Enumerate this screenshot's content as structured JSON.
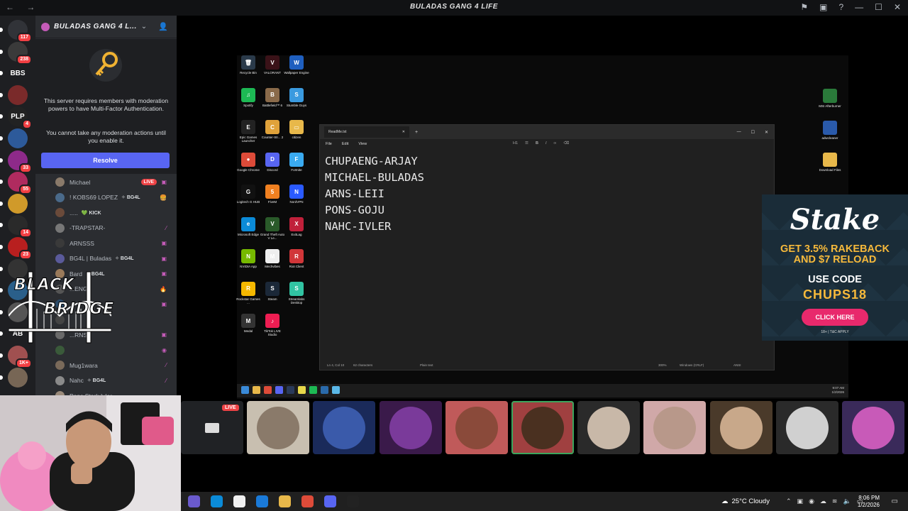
{
  "window": {
    "title": "BULADAS GANG 4 LIFE",
    "back": "←",
    "forward": "→"
  },
  "rail": {
    "items": [
      {
        "label": "",
        "badge": "117",
        "color": "#313338"
      },
      {
        "label": "",
        "badge": "238",
        "color": "#3a3a3a"
      },
      {
        "label": "BBS",
        "badge": "",
        "color": "#1e1f22"
      },
      {
        "label": "",
        "badge": "",
        "color": "#7a2a2a"
      },
      {
        "label": "PLP",
        "badge": "4",
        "color": "#222"
      },
      {
        "label": "",
        "badge": "",
        "color": "#2d5a9a"
      },
      {
        "label": "",
        "badge": "33",
        "color": "#8e2a8a"
      },
      {
        "label": "",
        "badge": "55",
        "color": "#b02b5f"
      },
      {
        "label": "",
        "badge": "",
        "color": "#d09a2a"
      },
      {
        "label": "",
        "badge": "14",
        "color": "#2a2a2a"
      },
      {
        "label": "",
        "badge": "23",
        "color": "#b81f1f"
      },
      {
        "label": "",
        "badge": "",
        "color": "#333"
      },
      {
        "label": "",
        "badge": "",
        "color": "#2a5f8a"
      },
      {
        "label": "",
        "badge": "",
        "color": "#555"
      },
      {
        "label": "AB",
        "badge": "",
        "color": "#1e1f22"
      },
      {
        "label": "",
        "badge": "1K+",
        "color": "#a05050"
      },
      {
        "label": "",
        "badge": "",
        "color": "#776655"
      }
    ]
  },
  "sidebar": {
    "server_name": "BULADAS GANG 4 L...",
    "mfa_text_1": "This server requires members with moderation powers to have Multi-Factor Authentication.",
    "mfa_text_2": "You cannot take any moderation actions until you enable it.",
    "resolve_label": "Resolve",
    "members": [
      {
        "name": "Michael",
        "tag": "",
        "live": "LIVE",
        "icon": "▣"
      },
      {
        "name": "! KOBS69 LOPEZ",
        "tag": "✧ BG4L",
        "live": "",
        "icon": "🍔"
      },
      {
        "name": ".....",
        "tag": "💚 KICK",
        "live": "",
        "icon": ""
      },
      {
        "name": "-TRAPSTAR-",
        "tag": "",
        "live": "",
        "icon": "⁄"
      },
      {
        "name": "ARNSSS",
        "tag": "",
        "live": "",
        "icon": "▣"
      },
      {
        "name": "BG4L | Buladas",
        "tag": "✧ BG4L",
        "live": "",
        "icon": "▣"
      },
      {
        "name": "Bard",
        "tag": "✧ BG4L",
        "live": "",
        "icon": "▣"
      },
      {
        "name": "...ENG",
        "tag": "",
        "live": "",
        "icon": "🔥"
      },
      {
        "name": "",
        "tag": "",
        "live": "",
        "icon": "▣"
      },
      {
        "name": "",
        "tag": "",
        "live": "",
        "icon": ""
      },
      {
        "name": "...RNS",
        "tag": "",
        "live": "",
        "icon": "▣"
      },
      {
        "name": "",
        "tag": "",
        "live": "",
        "icon": "◉"
      },
      {
        "name": "Mug1wara",
        "tag": "",
        "live": "",
        "icon": "⁄"
      },
      {
        "name": "Nahc",
        "tag": "✧ BG4L",
        "live": "",
        "icon": "⁄"
      },
      {
        "name": "Pons Stark Ivler",
        "tag": "",
        "live": "",
        "icon": ""
      }
    ]
  },
  "desktop_icons": [
    {
      "label": "Recycle Bin",
      "color": "#2a3a4a",
      "glyph": "🗑"
    },
    {
      "label": "VALORANT",
      "color": "#3a1218",
      "glyph": "V"
    },
    {
      "label": "Wallpaper Engine",
      "color": "#1f5fbf",
      "glyph": "W"
    },
    {
      "label": "Spotify",
      "color": "#1db954",
      "glyph": "♫"
    },
    {
      "label": "Battlefield™ 6",
      "color": "#8a6a4a",
      "glyph": "B"
    },
    {
      "label": "Stumble Guys",
      "color": "#3a9adf",
      "glyph": "S"
    },
    {
      "label": "Epic Games Launcher",
      "color": "#222",
      "glyph": "E"
    },
    {
      "label": "Counter-Str... 2",
      "color": "#e0a23a",
      "glyph": "C"
    },
    {
      "label": "citizen",
      "color": "#e8b84a",
      "glyph": "▭"
    },
    {
      "label": "Google Chrome",
      "color": "#dd4b39",
      "glyph": "●"
    },
    {
      "label": "Discord",
      "color": "#5865f2",
      "glyph": "D"
    },
    {
      "label": "Fortnite",
      "color": "#3aaaf0",
      "glyph": "F"
    },
    {
      "label": "Logitech G HUB",
      "color": "#111",
      "glyph": "G"
    },
    {
      "label": "FiveM",
      "color": "#f08020",
      "glyph": "5"
    },
    {
      "label": "NordVPN",
      "color": "#2a5aff",
      "glyph": "N"
    },
    {
      "label": "Microsoft Edge",
      "color": "#0b8bd8",
      "glyph": "e"
    },
    {
      "label": "Grand Theft Auto V Le...",
      "color": "#2a5a2a",
      "glyph": "V"
    },
    {
      "label": "ExitLag",
      "color": "#c0203a",
      "glyph": "X"
    },
    {
      "label": "NVIDIA App",
      "color": "#76b900",
      "glyph": "N"
    },
    {
      "label": "Mechvibes",
      "color": "#eee",
      "glyph": "M"
    },
    {
      "label": "Riot Client",
      "color": "#d13639",
      "glyph": "R"
    },
    {
      "label": "Rockstar Games ...",
      "color": "#f5b800",
      "glyph": "R"
    },
    {
      "label": "Steam",
      "color": "#1b2838",
      "glyph": "S"
    },
    {
      "label": "Streamlabs Desktop",
      "color": "#31c3a2",
      "glyph": "S"
    },
    {
      "label": "Medal",
      "color": "#333",
      "glyph": "M"
    },
    {
      "label": "TikTok LIVE Studio",
      "color": "#ee1d52",
      "glyph": "♪"
    }
  ],
  "desktop_right_icons": [
    {
      "label": "MSI Afterburner",
      "color": "#2a7a3a"
    },
    {
      "label": "adwcleaner",
      "color": "#2a5aaa"
    },
    {
      "label": "Download Files",
      "color": "#e8b84a"
    }
  ],
  "notepad": {
    "tab_title": "ReadMe.txt",
    "menu": [
      "File",
      "Edit",
      "View"
    ],
    "heading_tool": "H1",
    "lines": [
      "CHUPAENG-ARJAY",
      "MICHAEL-BULADAS",
      "ARNS-LEII",
      "PONS-GOJU",
      "NAHC-IVLER"
    ],
    "status_pos": "Ln 4, Col 10",
    "status_chars": "62 characters",
    "status_format": "Plain text",
    "status_zoom": "300%",
    "status_eol": "Windows (CRLF)",
    "status_enc": "ANSI"
  },
  "inner_taskbar": {
    "time": "9:07 AM",
    "date": "1/2/2026"
  },
  "stake_ad": {
    "logo": "Stake",
    "line1": "GET 3.5% RAKEBACK",
    "line1b": "AND $7 RELOAD",
    "line2": "USE CODE",
    "code": "CHUPS18",
    "button": "CLICK HERE",
    "fine": "18+ | T&C APPLY"
  },
  "overlay_logo": {
    "line1": "BLACK",
    "line2": "BRIDGE"
  },
  "call": {
    "live_tag": "LIVE",
    "tiles": [
      {
        "color": "#202225",
        "face": "#333"
      },
      {
        "color": "#c8bfb0",
        "face": "#8a7a6a"
      },
      {
        "color": "#1a2a5a",
        "face": "#3a5aaa"
      },
      {
        "color": "#3a1a4a",
        "face": "#7a3a9a"
      },
      {
        "color": "#c05a5a",
        "face": "#8a4a3a"
      },
      {
        "color": "#a04040",
        "face": "#4a3020"
      },
      {
        "color": "#2a2a2a",
        "face": "#c8b8a8"
      },
      {
        "color": "#d0a8a8",
        "face": "#b8988a"
      },
      {
        "color": "#4a3a2a",
        "face": "#c8a88a"
      },
      {
        "color": "#2a2a2a",
        "face": "#d0d0d0"
      },
      {
        "color": "#3a2a5a",
        "face": "#c85ab8"
      }
    ]
  },
  "taskbar": {
    "weather": "25°C Cloudy",
    "time": "8:06 PM",
    "date": "1/2/2026",
    "apps": [
      "#6a5acd",
      "#0b8bd8",
      "#f0f0f0",
      "#1a7ad8",
      "#e8b84a",
      "#dd4b39",
      "#5865f2",
      "#222"
    ]
  }
}
